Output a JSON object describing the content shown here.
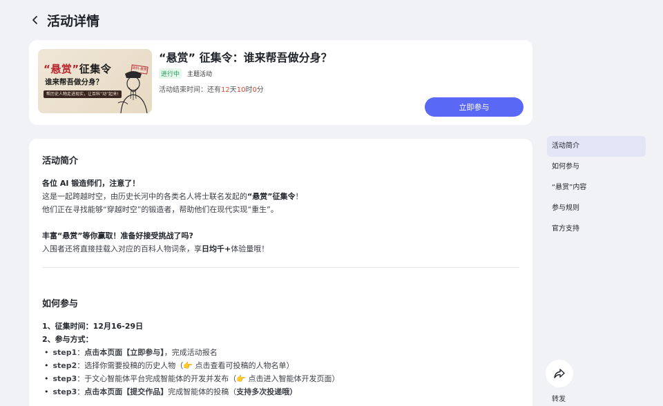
{
  "header": {
    "title": "活动详情"
  },
  "activity": {
    "banner": {
      "title_red": "“悬赏”",
      "title_black": "征集令",
      "subtitle": "谁来帮吾做分身？",
      "tag": "帮历史人物走进现实，让百科“动”起来!",
      "stamp": "百科·悬赏"
    },
    "title": "“悬赏” 征集令：谁来帮吾做分身？",
    "status": "进行中",
    "type": "主题活动",
    "countdown": {
      "label": "活动结束时间：还有",
      "days": "12",
      "days_unit": "天",
      "hours": "10",
      "hours_unit": "时",
      "minutes": "0",
      "minutes_unit": "分"
    },
    "join_label": "立即参与"
  },
  "intro": {
    "title": "活动简介",
    "heading": "各位 AI 锻造师们，注意了！",
    "p1_a": "这是一起跨越时空，由历史长河中的各类名人将士联名发起的",
    "p1_b": "“悬赏”征集令",
    "p1_c": "！",
    "p2": "他们正在寻找能够“穿越时空”的锻造者，帮助他们在现代实现“重生”。",
    "heading2": "丰富“悬赏”等你赢取！准备好接受挑战了吗?",
    "p3_a": "入围者还将直接挂载入对应的百科人物词条，享",
    "p3_b": "日均千+",
    "p3_c": "体验量哦！"
  },
  "howto": {
    "title": "如何参与",
    "item1": "1、征集时间：12月16-29日",
    "item2": "2、参与方式：",
    "steps": [
      {
        "label": "step1",
        "text_a": "：",
        "bold": "点击本页面【立即参与】",
        "text_b": "，完成活动报名",
        "link": "",
        "text_c": ""
      },
      {
        "label": "step2",
        "text_a": "：选择你需要投稿的历史人物（",
        "bold": "",
        "text_b": "",
        "link": "👉 点击查看可投稿的人物名单",
        "text_c": "）"
      },
      {
        "label": "step3",
        "text_a": "：于文心智能体平台完成智能体的开发并发布（",
        "bold": "",
        "text_b": "",
        "link": "👉 点击进入智能体开发页面",
        "text_c": "）"
      },
      {
        "label": "step3",
        "text_a": "：",
        "bold": "点击本页面【提交作品】",
        "text_b": "完成智能体的投稿（",
        "link": "",
        "text_c": "支持多次投递哦）"
      }
    ]
  },
  "side_nav": {
    "items": [
      "活动简介",
      "如何参与",
      "“悬赏”内容",
      "参与规则",
      "官方支持"
    ],
    "active_index": 0
  },
  "share": {
    "label": "转发"
  },
  "colors": {
    "accent": "#5a69f5",
    "link": "#3f5ff0",
    "countdown": "#e0462d",
    "status": "#1f9d55"
  }
}
